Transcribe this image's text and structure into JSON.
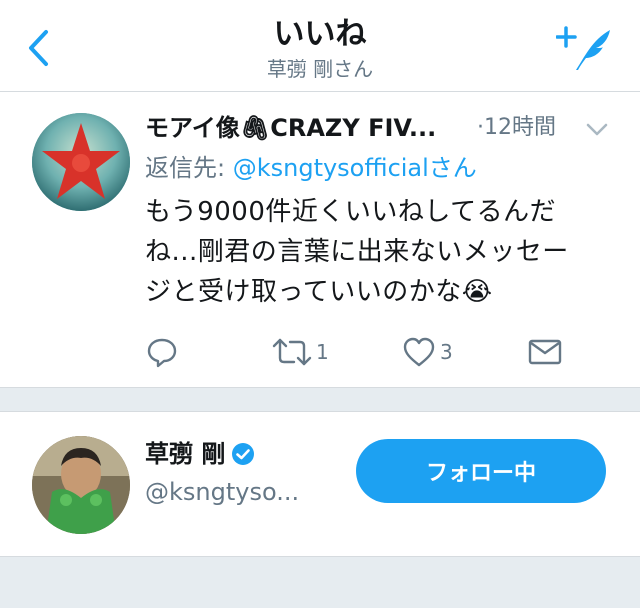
{
  "header": {
    "title": "いいね",
    "subtitle": "草彅 剛さん",
    "back_icon": "chevron-left-icon",
    "compose_icon": "compose-tweet-icon",
    "accent_color": "#1da1f2"
  },
  "tweet": {
    "author_name": "モアイ像🖇CRAZY FIV...",
    "timestamp": "·12時間",
    "reply_prefix": "返信先: ",
    "reply_handle": "@ksngtysofficialさん",
    "text_lines": [
      "もう9000件近くいいねしてるんだ",
      "ね...剛君の言葉に出来ないメッセー",
      "ジと受け取っていいのかな😭"
    ],
    "actions": {
      "reply": {
        "icon": "reply-icon",
        "count": ""
      },
      "retweet": {
        "icon": "retweet-icon",
        "count": "1"
      },
      "like": {
        "icon": "heart-icon",
        "count": "3"
      },
      "dm": {
        "icon": "envelope-icon",
        "count": ""
      }
    }
  },
  "user_card": {
    "name": "草彅 剛",
    "verified_icon": "verified-badge-icon",
    "handle": "@ksngtyso...",
    "follow_label": "フォロー中"
  }
}
